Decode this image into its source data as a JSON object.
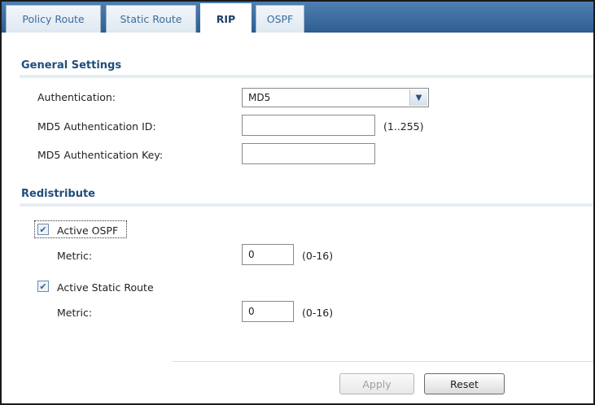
{
  "tabs": [
    {
      "label": "Policy Route"
    },
    {
      "label": "Static Route"
    },
    {
      "label": "RIP"
    },
    {
      "label": "OSPF"
    }
  ],
  "general": {
    "title": "General Settings",
    "authentication_label": "Authentication:",
    "authentication_value": "MD5",
    "md5_id_label": "MD5 Authentication ID:",
    "md5_id_value": "",
    "md5_id_hint": "(1..255)",
    "md5_key_label": "MD5 Authentication Key:",
    "md5_key_value": ""
  },
  "redistribute": {
    "title": "Redistribute",
    "ospf": {
      "label": "Active OSPF",
      "checked": true,
      "metric_label": "Metric:",
      "metric_value": "0",
      "metric_hint": "(0-16)"
    },
    "static": {
      "label": "Active Static Route",
      "checked": true,
      "metric_label": "Metric:",
      "metric_value": "0",
      "metric_hint": "(0-16)"
    }
  },
  "buttons": {
    "apply": "Apply",
    "reset": "Reset"
  }
}
